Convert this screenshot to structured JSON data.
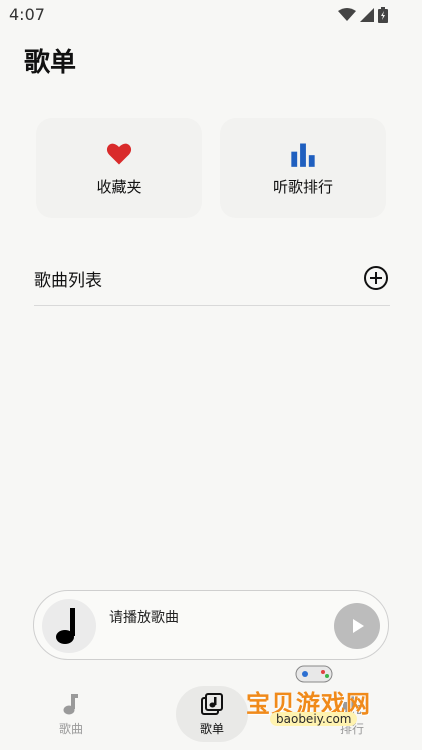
{
  "status": {
    "time": "4:07"
  },
  "header": {
    "title": "歌单"
  },
  "cards": [
    {
      "label": "收藏夹",
      "icon": "heart-icon",
      "color": "#d92b2b"
    },
    {
      "label": "听歌排行",
      "icon": "bar-chart-icon",
      "color": "#1f5fbf"
    }
  ],
  "list": {
    "title": "歌曲列表",
    "add_icon": "add-circle-icon"
  },
  "player": {
    "prompt": "请播放歌曲",
    "art_icon": "music-note-icon",
    "play_icon": "play-icon"
  },
  "nav": {
    "items": [
      {
        "label": "歌曲",
        "icon": "music-note-icon",
        "active": false
      },
      {
        "label": "歌单",
        "icon": "playlist-icon",
        "active": true
      },
      {
        "label": "排行",
        "icon": "ranking-icon",
        "active": false
      }
    ]
  },
  "watermark": {
    "title": "宝贝游戏网",
    "url": "baobeiy.com"
  }
}
